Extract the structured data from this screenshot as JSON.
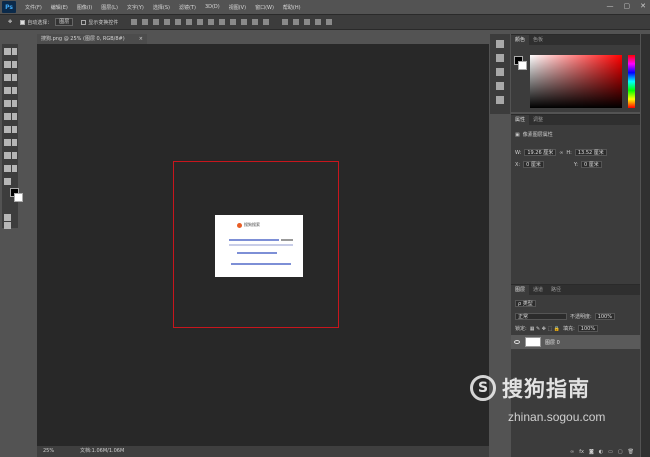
{
  "app": {
    "logo": "Ps"
  },
  "menu": [
    "文件(F)",
    "编辑(E)",
    "图像(I)",
    "图层(L)",
    "文字(Y)",
    "选择(S)",
    "滤镜(T)",
    "3D(D)",
    "视图(V)",
    "窗口(W)",
    "帮助(H)"
  ],
  "window_controls": {
    "min": "—",
    "max": "▢",
    "close": "✕"
  },
  "options": {
    "auto_select_label": "自动选择：",
    "auto_select_value": "图层",
    "show_transform_label": "显示变换控件"
  },
  "document": {
    "tab_title": "搜狗.png @ 25% (图层 0, RGB/8#)",
    "tab_close": "×",
    "image": {
      "brand": "搜狗搜索"
    }
  },
  "status": {
    "zoom": "25%",
    "doc_size": "文档:1.06M/1.06M"
  },
  "panels": {
    "color": {
      "tabs": [
        "颜色",
        "色板"
      ],
      "foreground": "#000000",
      "background": "#ffffff"
    },
    "properties": {
      "tabs": [
        "属性",
        "调整"
      ],
      "title": "像素图层属性",
      "w_label": "W:",
      "w_value": "19.26 厘米",
      "h_label": "H:",
      "h_value": "13.52 厘米",
      "x_label": "X:",
      "x_value": "0 厘米",
      "y_label": "Y:",
      "y_value": "0 厘米",
      "link": "∞"
    },
    "layers": {
      "tabs": [
        "图层",
        "通道",
        "路径"
      ],
      "filter": "ρ 类型",
      "blend_mode": "正常",
      "opacity_label": "不透明度:",
      "opacity_value": "100%",
      "lock_label": "锁定:",
      "fill_label": "填充:",
      "fill_value": "100%",
      "layer_name": "图层 0"
    }
  },
  "watermark": {
    "logo": "S",
    "text": "搜狗指南",
    "url": "zhinan.sogou.com"
  },
  "colors": {
    "frame_red": "#c8161d",
    "canvas_bg": "#282828",
    "ui_bg": "#535353"
  }
}
